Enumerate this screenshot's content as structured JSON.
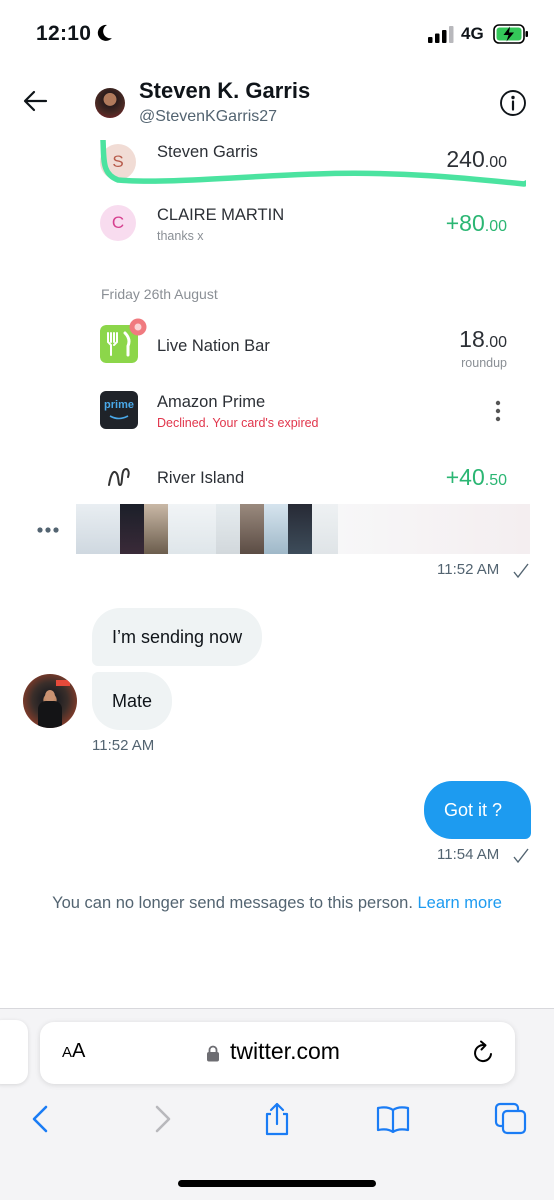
{
  "status_bar": {
    "time": "12:10",
    "network": "4G"
  },
  "header": {
    "name": "Steven K. Garris",
    "handle": "@StevenKGarris27"
  },
  "embedded_statement": {
    "top_row": {
      "initial": "S",
      "name": "Steven Garris",
      "amount_int": "240",
      "amount_dec": ".00"
    },
    "claire_row": {
      "initial": "C",
      "name": "CLAIRE MARTIN",
      "note": "thanks x",
      "amount_int": "+80",
      "amount_dec": ".00"
    },
    "date_header": "Friday 26th August",
    "live_nation": {
      "name": "Live Nation Bar",
      "amount_int": "18",
      "amount_dec": ".00",
      "note": "roundup"
    },
    "amazon": {
      "logo_text": "prime",
      "name": "Amazon Prime",
      "note": "Declined. Your card's expired"
    },
    "river_island": {
      "name": "River Island",
      "amount_int": "+40",
      "amount_dec": ".50"
    }
  },
  "image_message": {
    "time": "11:52 AM"
  },
  "incoming_messages": [
    {
      "text": "I’m sending now"
    },
    {
      "text": "Mate"
    }
  ],
  "incoming_time": "11:52 AM",
  "outgoing_message": {
    "text": "Got it ?",
    "time": "11:54 AM"
  },
  "notice": {
    "text": "You can no longer send messages to this person.",
    "link": "Learn more"
  },
  "browser": {
    "aa_label_small": "A",
    "aa_label": "A",
    "url": "twitter.com"
  },
  "colors": {
    "accent": "#1d9bf0",
    "positive": "#2bb673",
    "declined": "#e1364c",
    "highlight": "#4be3a0"
  }
}
